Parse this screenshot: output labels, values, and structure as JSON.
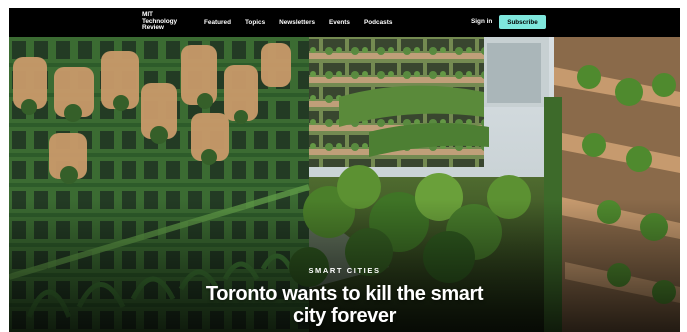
{
  "nav": {
    "logo_lines": [
      "MIT",
      "Technology",
      "Review"
    ],
    "links": [
      "Featured",
      "Topics",
      "Newsletters",
      "Events",
      "Podcasts"
    ],
    "sign_in": "Sign in",
    "subscribe": "Subscribe"
  },
  "hero": {
    "kicker": "SMART CITIES",
    "headline_line1": "Toronto wants to kill the smart",
    "headline_line2": "city forever"
  },
  "colors": {
    "nav_background": "#000000",
    "subscribe_button": "#7fe7dd",
    "text": "#ffffff"
  }
}
